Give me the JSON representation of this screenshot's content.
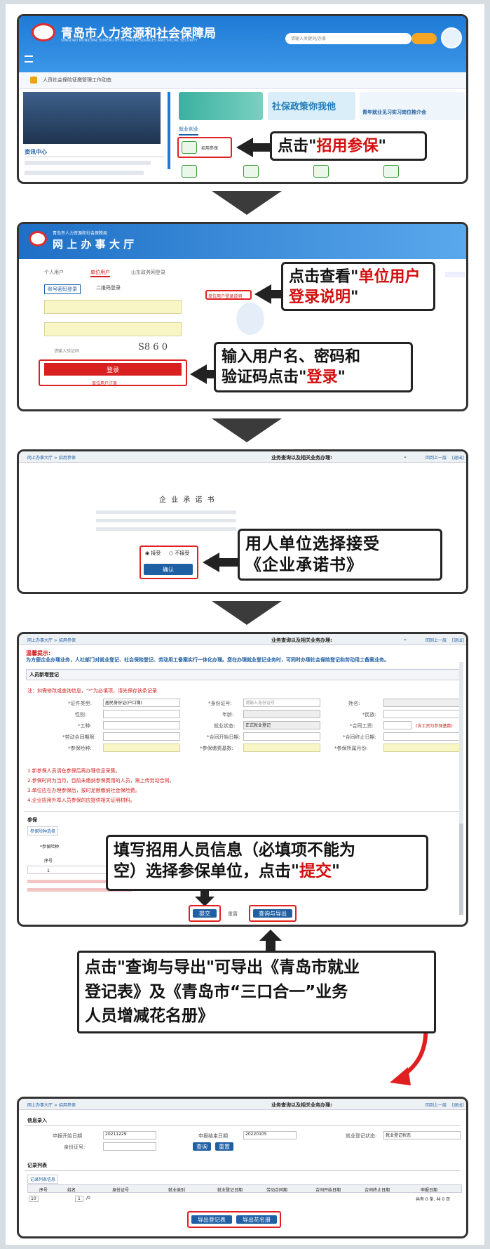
{
  "panel1": {
    "site_title": "青岛市人力资源和社会保障局",
    "site_subtitle": "QINGDAO MUNICIPAL BUREAU OF HUMAN RESOURCES AND SOCIAL SECURITY",
    "search_placeholder": "请输入关键词/办事",
    "notice": "人员社会保险征缴管理工作动态",
    "banner_text": "社保政策你我他",
    "banner_text2": "青年就业见习实习岗位推介会",
    "news_header": "资讯中心",
    "tab_label": "就业创业",
    "recruit_label": "招用参保",
    "callout_prefix": "点击\"",
    "callout_red": "招用参保",
    "callout_suffix": "\""
  },
  "panel2": {
    "site_title": "网 上 办 事 大 厅",
    "site_sub": "青岛市人力资源和社会保障局",
    "tab_personal": "个人用户",
    "tab_unit": "单位用户",
    "tab_other": "山东政务网登录",
    "login_type1": "账号密码登录",
    "login_type2": "二维码登录",
    "captcha_placeholder": "请输入验证码",
    "captcha": "S8 6 0",
    "login_button": "登录",
    "unit_register": "单位用户注册",
    "help_link": "单位用户登录说明",
    "callout1_prefix": "点击查看\"",
    "callout1_red": "单位用户登录说明",
    "callout1_suffix": "\"",
    "callout2_line1": "输入用户名、密码和",
    "callout2_line2_prefix": "验证码点击\"",
    "callout2_red": "登录",
    "callout2_suffix": "\""
  },
  "panel3": {
    "breadcrumb": "网上办事大厅 > 招用参保",
    "query_label": "业务查询以及相关业务办理:",
    "prev_link": "回到上一层",
    "exit_link": "[退出]",
    "doc_title": "企 业 承 诺 书",
    "accept": "接受",
    "reject": "不接受",
    "confirm_button": "确认",
    "callout_line1": "用人单位选择接受",
    "callout_line2": "《企业承诺书》"
  },
  "panel4": {
    "breadcrumb": "网上办事大厅 > 招用参保",
    "query_label": "业务查询以及相关业务办理:",
    "prev_link": "回到上一层",
    "exit_link": "[退出]",
    "tip_title": "温馨提示:",
    "tip_text": "为方便企业办理业务，人社部门对就业登记、社会保险登记、劳动用工备案实行一体化办理。您在办理就业登记业务时，可同时办理社会保险登记和劳动用工备案业务。",
    "section_title": "人员新增登记",
    "note_red": "注：如需修改或查询信息，\"*\"为必填项，请先保存该条记录",
    "labels": [
      "*证件类型:",
      "*身份证号:",
      "姓名:",
      "性别:",
      "年龄:",
      "*民族:",
      "*工种:",
      "就业状态:",
      "*合同工资:",
      "*劳动合同期限:",
      "*合同开始日期:",
      "*合同终止日期:",
      "*参保险种:",
      "*参保缴费基数:",
      "*参保所属月份:"
    ],
    "id_type_value": "居民身份证(户口簿)",
    "id_input_placeholder": "请输入身份证号",
    "employment_value": "正式就业登记",
    "contract_note": "(含工资为参保基数)",
    "notes_red": [
      "1.新参保人员请在参保后再办理信息采集。",
      "2.参保时间为当月，目前未缴纳参保费用的人员，需上传劳动合同。",
      "3.单位应在办理参保后，按时足额缴纳社会保险费。",
      "4.企业招用外埠人员参保的应提供相关证明材料。"
    ],
    "insurance_label": "参保",
    "insurance_tab": "参保险种选择",
    "unit_label": "*参保险种",
    "col_no": "序号",
    "row_no": "1",
    "submit_button": "提交",
    "reset_label": "重置",
    "export_button": "查询与导出",
    "callout_line1": "填写招用人员信息（必填项不能为",
    "callout_line2_prefix": "空）选择参保单位，点击\"",
    "callout_red": "提交",
    "callout_suffix": "\""
  },
  "export_callout": {
    "line1": "点击\"查询与导出\"可导出《青岛市就业",
    "line2": "登记表》及《青岛市“三口合一”业务",
    "line3": "人员增减花名册》"
  },
  "panel5": {
    "breadcrumb": "网上办事大厅 > 招用参保",
    "query_label": "业务查询以及相关业务办理:",
    "prev_link": "回到上一层",
    "exit_link": "[退出]",
    "section": "信息录入",
    "start_label": "申报开始日期",
    "start_value": "20211229",
    "end_label": "申报结束日期",
    "end_value": "20220105",
    "status_label": "就业登记状态:",
    "status_value": "就业登记状态",
    "id_label": "身份证号:",
    "query_button": "查询",
    "reset_button": "重置",
    "list_title": "记录列表",
    "list_tab": "记录列表信息",
    "columns": [
      "序号",
      "姓名",
      "身份证号",
      "就业类别",
      "就业登记日期",
      "劳动合同期",
      "合同开始日期",
      "合同终止日期",
      "申报日期"
    ],
    "pager": "10",
    "page_info": "1",
    "total_pages": "/0",
    "result_text": "共有 0 条, 共 0 页",
    "export_btn1": "导出登记表",
    "export_btn2": "导出花名册"
  }
}
